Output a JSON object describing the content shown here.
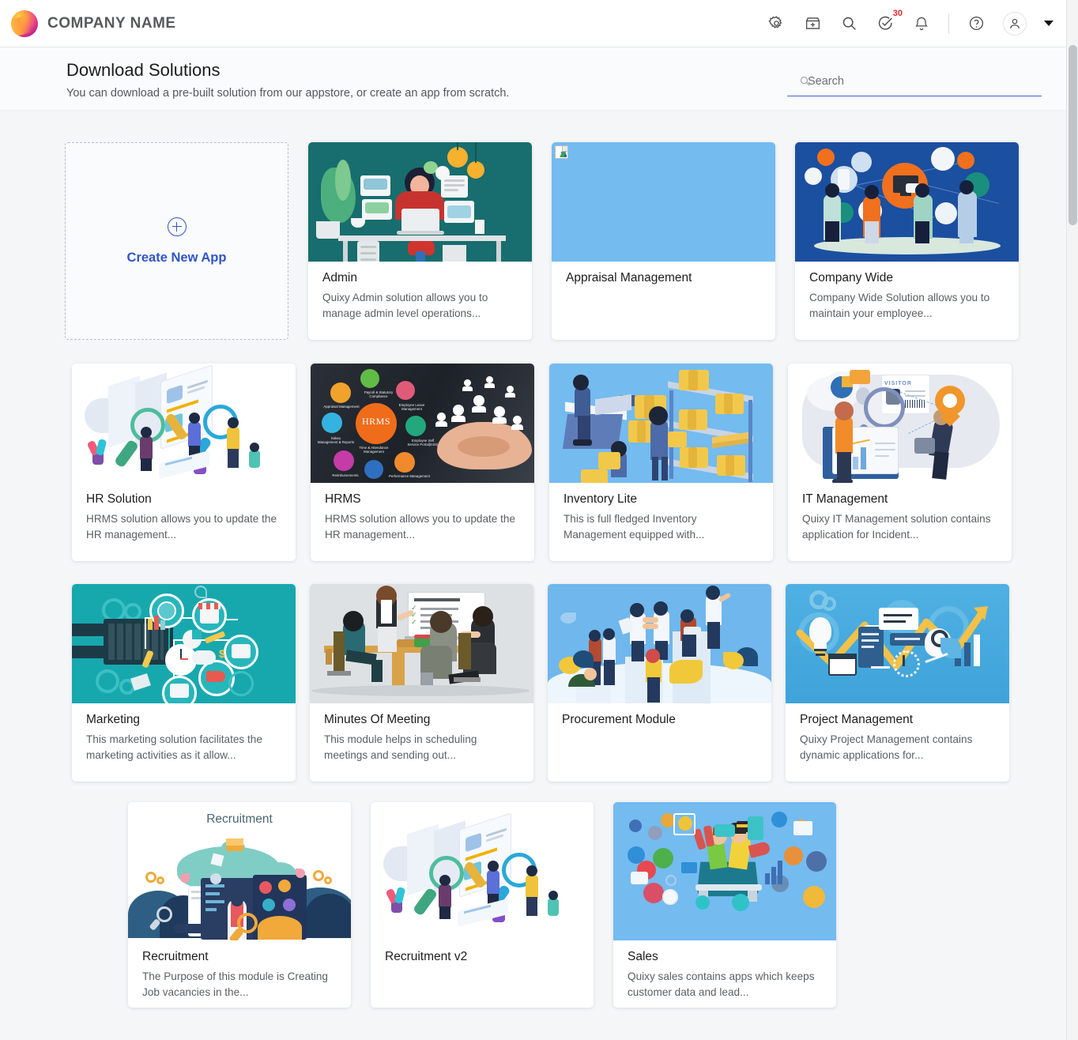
{
  "header": {
    "brand_name": "COMPANY NAME",
    "logo_icon": "company-sphere-logo",
    "icons": [
      {
        "name": "settings-gear-icon",
        "label": "Settings"
      },
      {
        "name": "app-store-icon",
        "label": "App Store"
      },
      {
        "name": "search-icon",
        "label": "Search"
      },
      {
        "name": "tasks-check-icon",
        "label": "Tasks",
        "badge": "30"
      },
      {
        "name": "notification-bell-icon",
        "label": "Notifications"
      },
      {
        "name": "help-icon",
        "label": "Help"
      },
      {
        "name": "user-avatar-icon",
        "label": "Account"
      },
      {
        "name": "chevron-down-icon",
        "label": "Account menu"
      }
    ],
    "task_badge_count": "30",
    "badge_color": "#e8272c"
  },
  "page": {
    "title": "Download Solutions",
    "subtitle": "You can download a pre-built solution from our appstore, or create an app from scratch."
  },
  "search": {
    "placeholder": "Search",
    "value": "",
    "icon": "search-icon",
    "underline_color": "#3f67d8"
  },
  "create_card": {
    "label": "Create New App",
    "icon": "plus-circle-icon",
    "accent_color": "#2f55c9"
  },
  "solutions": [
    {
      "title": "Admin",
      "description": "Quixy Admin solution allows you to manage admin level operations...",
      "thumb_bg": "#186d6e",
      "thumb_kind": "admin-desk-illustration"
    },
    {
      "title": "Appraisal Management",
      "description": "",
      "thumb_bg": "#74bbf0",
      "thumb_kind": "broken-image-placeholder"
    },
    {
      "title": "Company Wide",
      "description": "Company Wide Solution allows you to maintain your employee...",
      "thumb_bg": "#1b4fa0",
      "thumb_kind": "social-network-illustration"
    },
    {
      "title": "HR Solution",
      "description": "HRMS solution allows you to update the HR management...",
      "thumb_bg": "#ffffff",
      "thumb_kind": "resume-review-illustration"
    },
    {
      "title": "HRMS",
      "description": "HRMS solution allows you to update the HR management...",
      "thumb_bg": "#22262b",
      "thumb_kind": "hrms-hands-illustration"
    },
    {
      "title": "Inventory Lite",
      "description": "This is full fledged Inventory Management equipped with...",
      "thumb_bg": "#74bbf0",
      "thumb_kind": "warehouse-illustration"
    },
    {
      "title": "IT Management",
      "description": "Quixy IT Management solution contains application for Incident...",
      "thumb_bg": "#ffffff",
      "thumb_kind": "it-visitor-badge-illustration"
    },
    {
      "title": "Marketing",
      "description": "This marketing solution facilitates the marketing activities as it allow...",
      "thumb_bg": "#17a8ae",
      "thumb_kind": "marketing-keyboard-illustration"
    },
    {
      "title": "Minutes Of Meeting",
      "description": "This module helps in scheduling meetings and sending out...",
      "thumb_bg": "#dde1e4",
      "thumb_kind": "meeting-room-illustration"
    },
    {
      "title": "Procurement Module",
      "description": "",
      "thumb_bg": "#6fb7ec",
      "thumb_kind": "podium-people-illustration"
    },
    {
      "title": "Project Management",
      "description": "Quixy Project Management contains dynamic applications for...",
      "thumb_bg": "#53aede",
      "thumb_kind": "zigzag-arrow-illustration"
    },
    {
      "title": "Recruitment",
      "description": "The Purpose of this module is Creating Job vacancies in the...",
      "thumb_bg": "#ffffff",
      "thumb_kind": "recruitment-illustration",
      "thumb_inner_title": "Recruitment"
    },
    {
      "title": "Recruitment v2",
      "description": "",
      "thumb_bg": "#ffffff",
      "thumb_kind": "resume-review-illustration"
    },
    {
      "title": "Sales",
      "description": "Quixy sales contains apps which keeps customer data and lead...",
      "thumb_bg": "#74bbf0",
      "thumb_kind": "sales-cart-illustration"
    }
  ]
}
